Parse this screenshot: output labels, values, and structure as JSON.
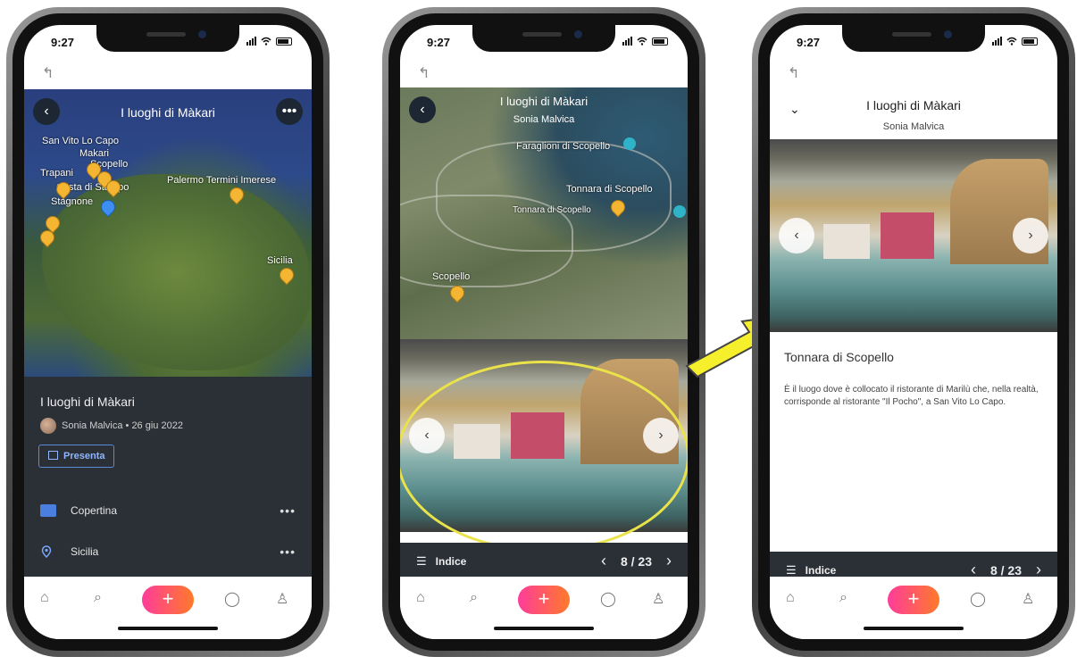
{
  "status": {
    "time": "9:27"
  },
  "common": {
    "back_arrow": "↰",
    "plus": "+"
  },
  "phone1": {
    "map_title": "I luoghi di Màkari",
    "labels": [
      {
        "text": "San Vito Lo Capo"
      },
      {
        "text": "Makari"
      },
      {
        "text": "Scopello"
      },
      {
        "text": "Trapani"
      },
      {
        "text": "Costa di Stampo"
      },
      {
        "text": "Stagnone"
      },
      {
        "text": "Palermo Termini Imerese"
      },
      {
        "text": "Sicilia"
      }
    ],
    "sheet": {
      "title": "I luoghi di Màkari",
      "author": "Sonia Malvica • 26 giu 2022",
      "present_button": "Presenta",
      "rows": [
        {
          "label": "Copertina",
          "icon": "image-icon"
        },
        {
          "label": "Sicilia",
          "icon": "pin-icon"
        }
      ]
    }
  },
  "phone2": {
    "title": "I luoghi di Màkari",
    "subtitle": "Sonia Malvica",
    "labels": [
      {
        "text": "Faraglioni di Scopello"
      },
      {
        "text": "Tonnara di Scopello"
      },
      {
        "text": "Tonnara di Scopello"
      },
      {
        "text": "Scopello"
      }
    ],
    "page_bar": {
      "index_label": "Indice",
      "page": "8 / 23"
    }
  },
  "phone3": {
    "title": "I luoghi di Màkari",
    "subtitle": "Sonia Malvica",
    "place_title": "Tonnara di Scopello",
    "description": "È il luogo dove è collocato il ristorante di Marilù che, nella realtà, corrisponde al ristorante \"Il Pocho\", a San Vito Lo Capo.",
    "page_bar": {
      "index_label": "Indice",
      "page": "8 / 23"
    }
  },
  "colors": {
    "accent": "#ff3c9a",
    "highlight": "#f6ef2b",
    "sheet": "#2b2f36"
  }
}
